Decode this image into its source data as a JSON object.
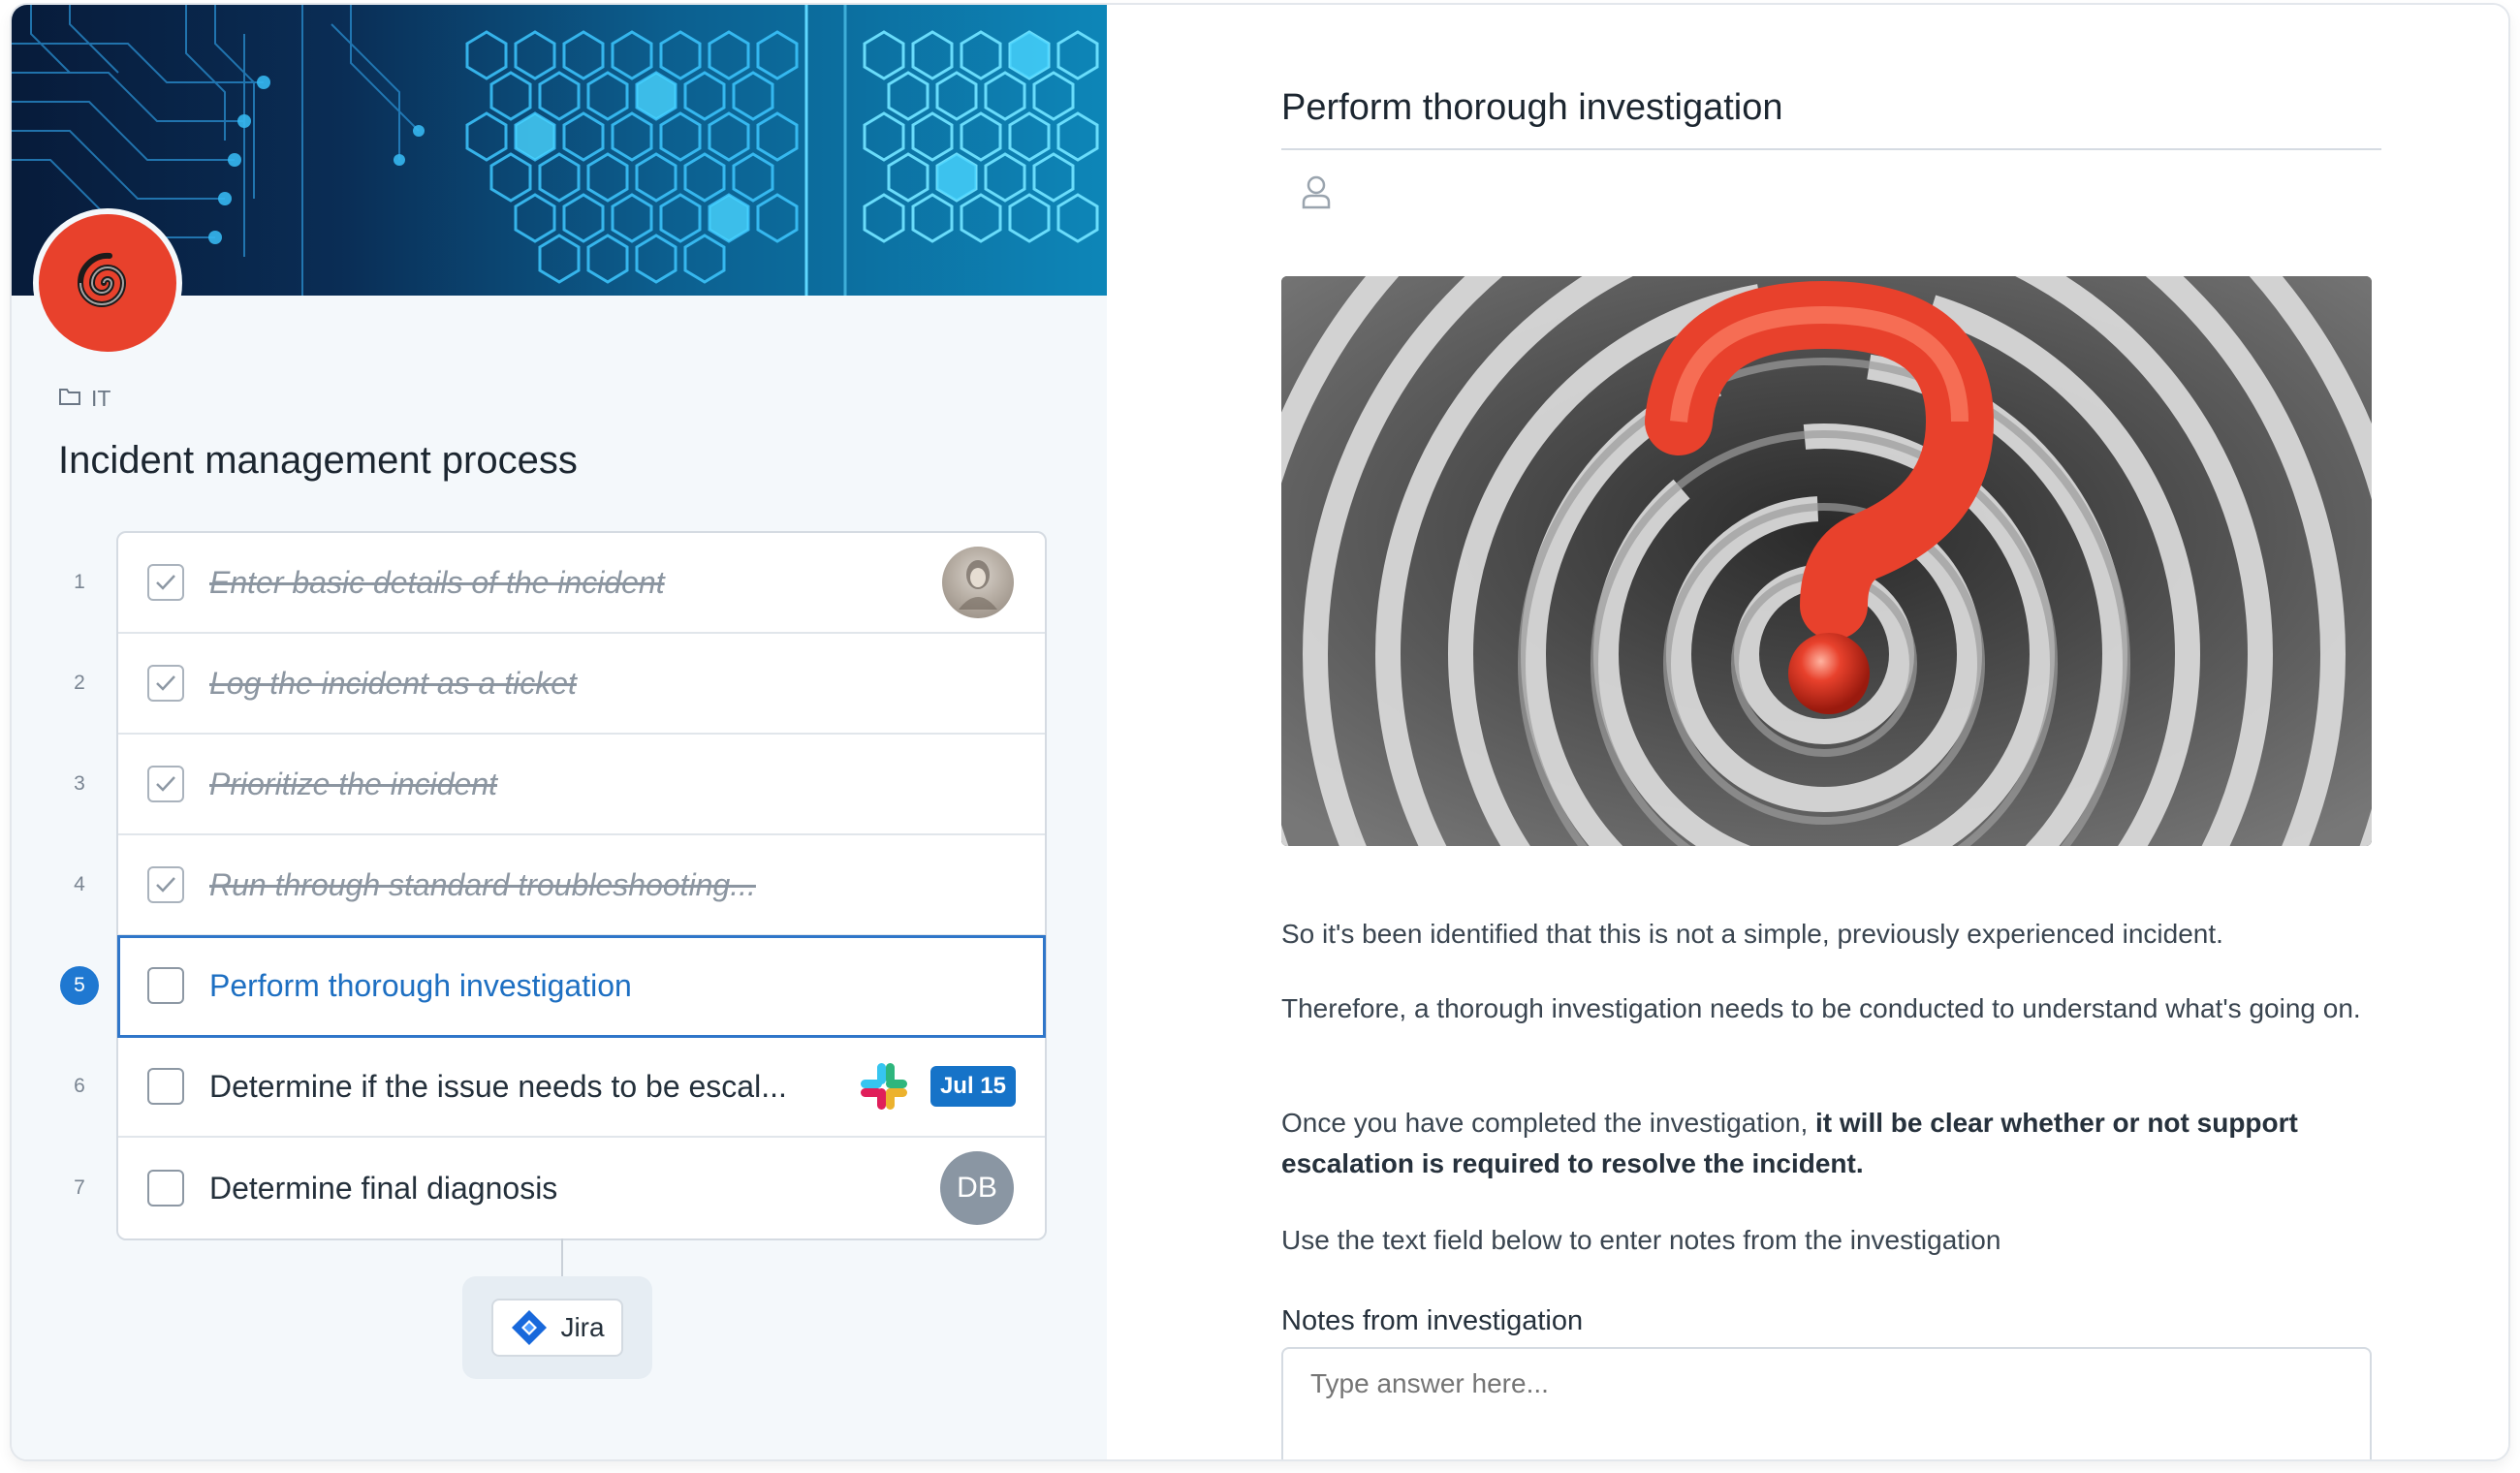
{
  "workflow": {
    "folder": "IT",
    "title": "Incident management process",
    "steps": [
      {
        "number": "1",
        "label": "Enter basic details of the incident",
        "status": "done"
      },
      {
        "number": "2",
        "label": "Log the incident as a ticket",
        "status": "done"
      },
      {
        "number": "3",
        "label": "Prioritize the incident",
        "status": "done"
      },
      {
        "number": "4",
        "label": "Run through standard troubleshooting...",
        "status": "done"
      },
      {
        "number": "5",
        "label": "Perform thorough investigation",
        "status": "active"
      },
      {
        "number": "6",
        "label": "Determine if the issue needs to be escal...",
        "status": "todo",
        "due": "Jul 15"
      },
      {
        "number": "7",
        "label": "Determine final diagnosis",
        "status": "todo",
        "assignee_initials": "DB"
      }
    ],
    "integration": "Jira"
  },
  "detail": {
    "title": "Perform thorough investigation",
    "paragraph1": "So it's been identified that this is not a simple, previously experienced incident.",
    "paragraph2": "Therefore, a thorough investigation needs to be conducted to understand what's going on.",
    "paragraph3_prefix": "Once you have completed the investigation, ",
    "paragraph3_bold": "it will be clear whether or not support escalation is required to resolve the incident.",
    "paragraph4": "Use the text field below to enter notes from the investigation",
    "notes_label": "Notes from investigation",
    "notes_placeholder": "Type answer here..."
  },
  "icons": [
    "logo-spiral-icon",
    "folder-icon",
    "check-icon",
    "slack-icon",
    "jira-icon",
    "user-icon"
  ],
  "colors": {
    "accent": "#1d6fc2",
    "logo": "#e8412c",
    "badge": "#1673c8"
  }
}
